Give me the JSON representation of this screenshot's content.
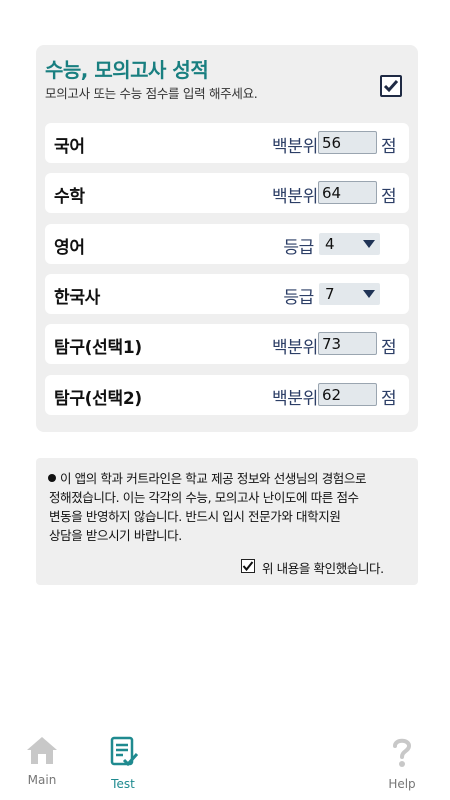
{
  "card": {
    "title": "수능, 모의고사 성적",
    "subtitle": "모의고사 또는 수능 점수를 입력 해주세요.",
    "checked": true
  },
  "rows": [
    {
      "subject": "국어",
      "kind": "백분위",
      "value": "56",
      "unit": "점"
    },
    {
      "subject": "수학",
      "kind": "백분위",
      "value": "64",
      "unit": "점"
    },
    {
      "subject": "영어",
      "kind": "등급",
      "value": "4"
    },
    {
      "subject": "한국사",
      "kind": "등급",
      "value": "7"
    },
    {
      "subject": "탐구(선택1)",
      "kind": "백분위",
      "value": "73",
      "unit": "점"
    },
    {
      "subject": "탐구(선택2)",
      "kind": "백분위",
      "value": "62",
      "unit": "점"
    }
  ],
  "notice": {
    "lines": [
      "이 앱의 학과 커트라인은 학교 제공 정보와 선생님의 경험으로",
      "정해졌습니다. 이는 각각의 수능, 모의고사 난이도에 따른 점수",
      "변동을 반영하지 않습니다. 반드시 입시 전문가와 대학지원",
      "상담을 받으시기 바랍니다."
    ],
    "confirm_label": "위 내용을 확인했습니다.",
    "confirm_checked": true
  },
  "nav": {
    "main": "Main",
    "test": "Test",
    "help": "Help"
  },
  "colors": {
    "title": "#197f80",
    "accent": "#1f8a8f",
    "inactive": "#c8c8c8",
    "label": "#2c3e66"
  }
}
